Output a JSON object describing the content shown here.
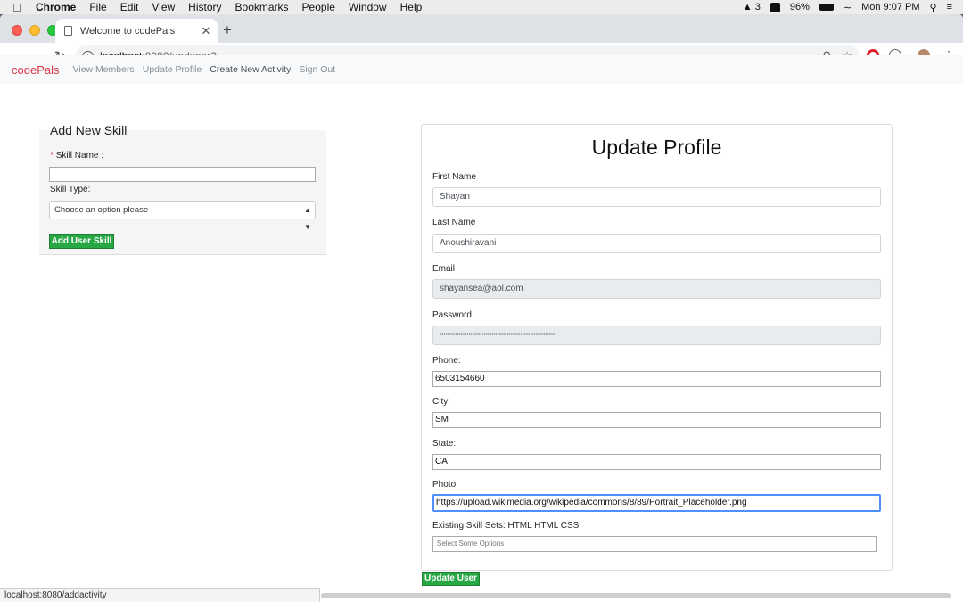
{
  "menubar": {
    "app": "Chrome",
    "items": [
      "File",
      "Edit",
      "View",
      "History",
      "Bookmarks",
      "People",
      "Window",
      "Help"
    ],
    "adobe_count": "3",
    "battery": "96%",
    "clock": "Mon 9:07 PM"
  },
  "browser": {
    "tab_title": "Welcome to codePals",
    "url_host": "localhost",
    "url_path": ":8080/upduser?",
    "status_url": "localhost:8080/addactivity"
  },
  "navbar": {
    "brand": "codePals",
    "links": [
      "View Members",
      "Update Profile",
      "Create New Activity",
      "Sign Out"
    ]
  },
  "skill_form": {
    "legend": "Add New Skill",
    "required_mark": "*",
    "skill_name_label": "Skill Name :",
    "skill_name_value": "",
    "skill_type_label": "Skill Type:",
    "skill_type_selected": "Choose an option please",
    "submit_label": "Add User Skill"
  },
  "profile_form": {
    "title": "Update Profile",
    "first_name_label": "First Name",
    "first_name": "Shayan",
    "last_name_label": "Last Name",
    "last_name": "Anoushiravani",
    "email_label": "Email",
    "email": "shayansea@aol.com",
    "password_label": "Password",
    "password_mask": "••••••••••••••••••••••••••••••••••••••••••••••••••••••••••••",
    "phone_label": "Phone:",
    "phone": "6503154660",
    "city_label": "City:",
    "city": "SM",
    "state_label": "State:",
    "state": "CA",
    "photo_label": "Photo:",
    "photo": "https://upload.wikimedia.org/wikipedia/commons/8/89/Portrait_Placeholder.png",
    "skills_label": "Existing Skill Sets: HTML HTML CSS",
    "skills_placeholder": "Select Some Options",
    "submit_label": "Update User"
  }
}
